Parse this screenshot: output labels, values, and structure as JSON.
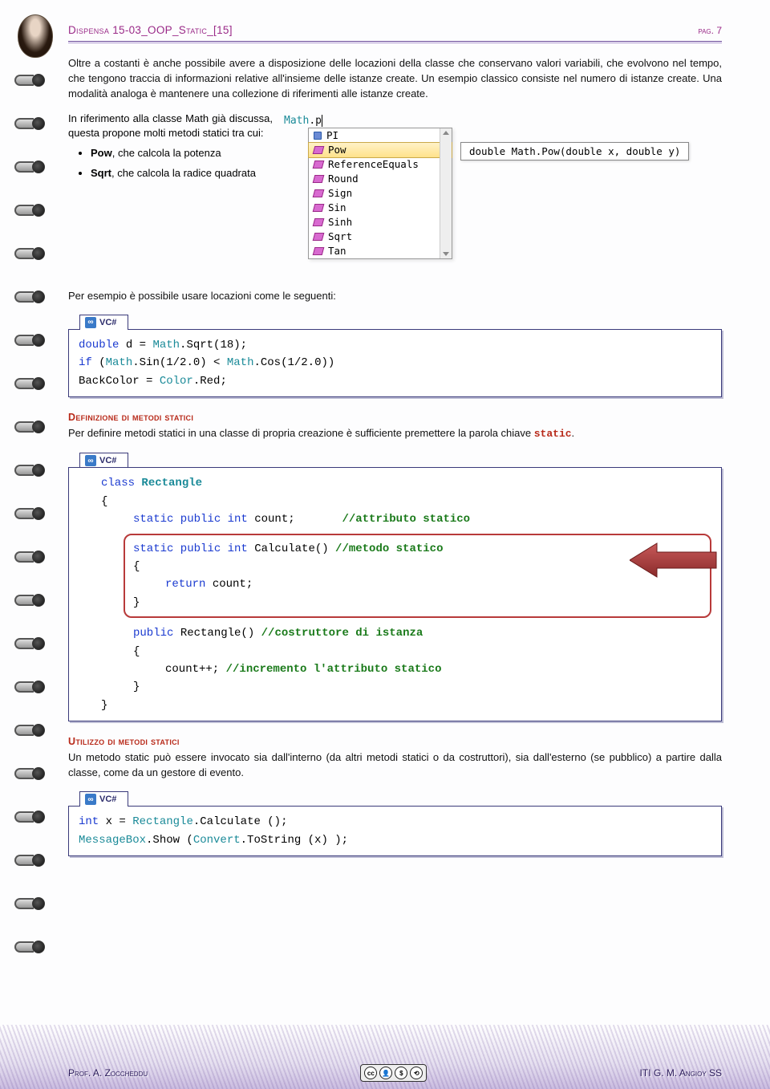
{
  "header": {
    "title": "Dispensa 15-03_OOP_Static_[15]",
    "page_label": "pag. 7"
  },
  "para1": "Oltre a costanti è anche possibile avere a disposizione delle locazioni della classe che conservano valori variabili, che evolvono nel tempo, che tengono traccia di informazioni relative all'insieme delle istanze create. Un esempio classico consiste nel numero di istanze create. Una modalità analoga è mantenere una collezione di riferimenti alle istanze create.",
  "math_intro": "In riferimento alla classe Math già discussa, questa propone molti metodi statici tra cui:",
  "bullets": {
    "pow_bold": "Pow",
    "pow_rest": ", che calcola la potenza",
    "sqrt_bold": "Sqrt",
    "sqrt_rest": ", che calcola la radice quadrata"
  },
  "intellisense": {
    "typed_class": "Math",
    "typed_suffix": ".p",
    "items": [
      {
        "kind": "field",
        "label": "PI"
      },
      {
        "kind": "method",
        "label": "Pow",
        "selected": true
      },
      {
        "kind": "method",
        "label": "ReferenceEquals"
      },
      {
        "kind": "method",
        "label": "Round"
      },
      {
        "kind": "method",
        "label": "Sign"
      },
      {
        "kind": "method",
        "label": "Sin"
      },
      {
        "kind": "method",
        "label": "Sinh"
      },
      {
        "kind": "method",
        "label": "Sqrt"
      },
      {
        "kind": "method",
        "label": "Tan"
      }
    ],
    "tooltip": "double Math.Pow(double x, double y)"
  },
  "para_example": "Per esempio è possibile usare locazioni come le seguenti:",
  "vc_label": "VC#",
  "code1": {
    "l1a": "double",
    "l1b": " d = ",
    "l1c": "Math",
    "l1d": ".Sqrt(18);",
    "l2a": "if",
    "l2b": " (",
    "l2c": "Math",
    "l2d": ".Sin(1/2.0) < ",
    "l2e": "Math",
    "l2f": ".Cos(1/2.0))",
    "l3a": "BackColor = ",
    "l3b": "Color",
    "l3c": ".Red;"
  },
  "section_def": "Definizione di metodi statici",
  "para_def": "Per definire metodi statici in una classe di propria creazione è sufficiente premettere la parola chiave ",
  "kw_static": "static",
  "code2": {
    "l1a": "class",
    "l1b": "Rectangle",
    "l2": "{",
    "l3a": "static public int",
    "l3b": " count;",
    "l3c": "//attributo statico",
    "l4a": "static public int",
    "l4b": " Calculate()  ",
    "l4c": "//metodo statico",
    "l5": "{",
    "l6a": "return",
    "l6b": " count;",
    "l7": "}",
    "l8a": "public",
    "l8b": " Rectangle() ",
    "l8c": "//costruttore di istanza",
    "l9": "{",
    "l10a": "count++; ",
    "l10b": "//incremento l'attributo statico",
    "l11": "}",
    "l12": "}"
  },
  "section_use": "Utilizzo di metodi statici",
  "para_use": "Un metodo static può essere invocato sia dall'interno (da altri metodi statici o da costruttori), sia dall'esterno (se pubblico) a partire dalla classe, come da un gestore di evento.",
  "code3": {
    "l1a": "int",
    "l1b": " x = ",
    "l1c": "Rectangle",
    "l1d": ".Calculate ();",
    "l2a": "MessageBox",
    "l2b": ".Show (",
    "l2c": "Convert",
    "l2d": ".ToString (x) );"
  },
  "footer": {
    "left": "Prof. A. Zoccheddu",
    "right": "ITI G. M. Angioy SS",
    "cc": {
      "c1": "cc",
      "c2": "①",
      "c3": "$",
      "c4": "©",
      "sub": "BY   NC   SA"
    }
  }
}
